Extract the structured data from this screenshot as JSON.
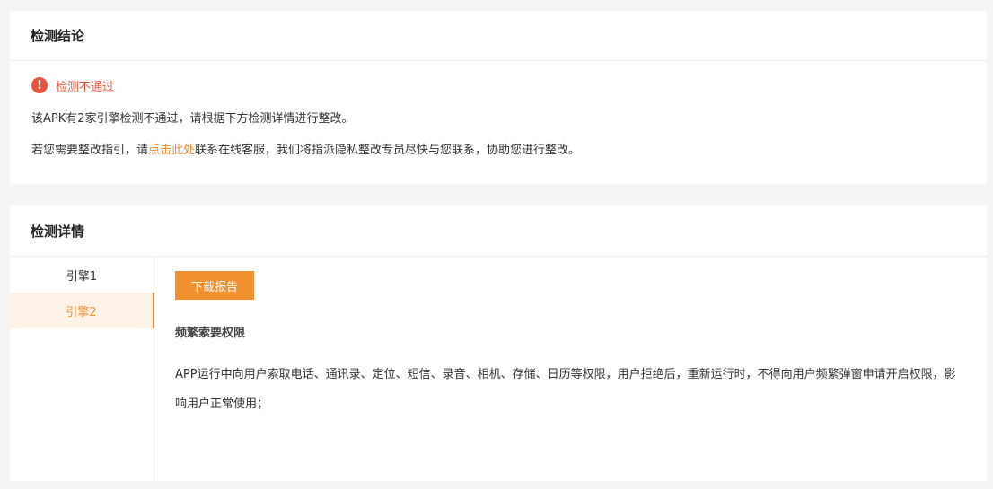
{
  "conclusion": {
    "title": "检测结论",
    "status_text": "检测不通过",
    "status_icon": "exclamation-circle-icon",
    "summary": "该APK有2家引擎检测不通过，请根据下方检测详情进行整改。",
    "guide_prefix": "若您需要整改指引，请",
    "guide_link": "点击此处",
    "guide_suffix": "联系在线客服，我们将指派隐私整改专员尽快与您联系，协助您进行整改。"
  },
  "details": {
    "title": "检测详情",
    "engines": [
      {
        "label": "引擎1",
        "active": false
      },
      {
        "label": "引擎2",
        "active": true
      }
    ],
    "download_label": "下载报告",
    "issue_title": "频繁索要权限",
    "issue_description": "APP运行中向用户索取电话、通讯录、定位、短信、录音、相机、存储、日历等权限，用户拒绝后，重新运行时，不得向用户频繁弹窗申请开启权限，影响用户正常使用；"
  },
  "colors": {
    "accent": "#f0902f",
    "error": "#e8553e",
    "active_bg": "#fef3e6",
    "page_bg": "#f5f5f5"
  }
}
